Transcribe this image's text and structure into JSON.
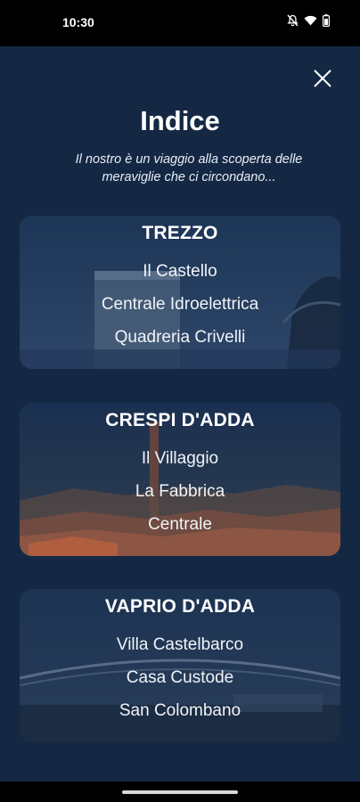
{
  "status_bar": {
    "time": "10:30",
    "icons": [
      "notifications-off-icon",
      "wifi-icon",
      "battery-icon"
    ]
  },
  "header": {
    "title": "Indice",
    "subtitle": "Il nostro è un viaggio alla scoperta delle meraviglie che ci circondano..."
  },
  "close_icon": "close-icon",
  "sections": [
    {
      "title": "TREZZO",
      "items": [
        "Il Castello",
        "Centrale Idroelettrica",
        "Quadreria Crivelli"
      ]
    },
    {
      "title": "CRESPI D'ADDA",
      "items": [
        "Il Villaggio",
        "La Fabbrica",
        "Centrale"
      ]
    },
    {
      "title": "VAPRIO D'ADDA",
      "items": [
        "Villa Castelbarco",
        "Casa Custode",
        "San Colombano"
      ]
    }
  ],
  "colors": {
    "background": "#142844",
    "text": "#ffffff"
  }
}
